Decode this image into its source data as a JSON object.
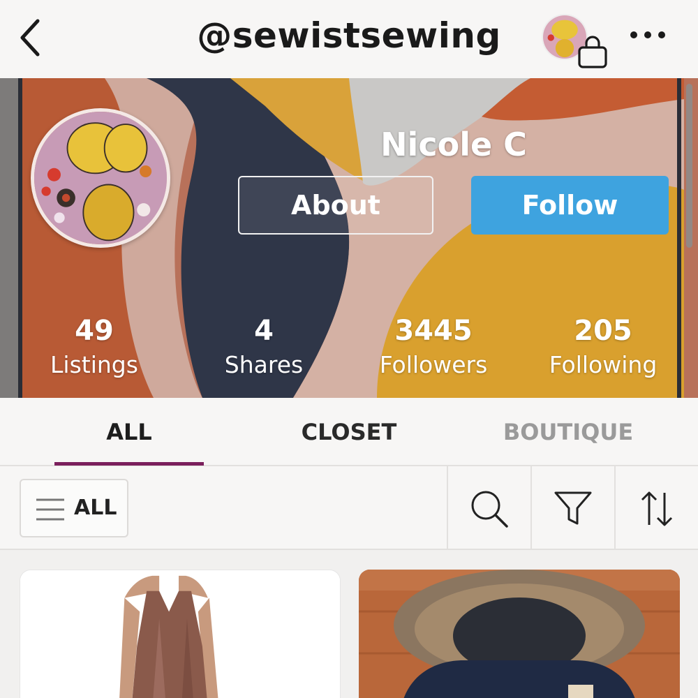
{
  "header": {
    "handle": "@sewistsewing",
    "back_icon": "chevron-left-icon",
    "bag_icon": "shopping-bag-icon",
    "more_icon": "more-horizontal-icon"
  },
  "profile": {
    "name": "Nicole C",
    "about_label": "About",
    "follow_label": "Follow",
    "follow_color": "#3ea3df"
  },
  "stats": [
    {
      "value": "49",
      "label": "Listings"
    },
    {
      "value": "4",
      "label": "Shares"
    },
    {
      "value": "3445",
      "label": "Followers"
    },
    {
      "value": "205",
      "label": "Following"
    }
  ],
  "tabs": [
    {
      "label": "ALL",
      "active": true
    },
    {
      "label": "CLOSET",
      "active": false
    },
    {
      "label": "BOUTIQUE",
      "active": false
    }
  ],
  "tab_accent_color": "#7b1f5c",
  "toolbar": {
    "filter_label": "ALL",
    "menu_icon": "menu-lines-icon",
    "search_icon": "search-icon",
    "filter_icon": "funnel-icon",
    "sort_icon": "sort-arrows-icon"
  },
  "listings": [
    {
      "image": "satin-slip-dress"
    },
    {
      "image": "fur-hood-parka"
    }
  ]
}
